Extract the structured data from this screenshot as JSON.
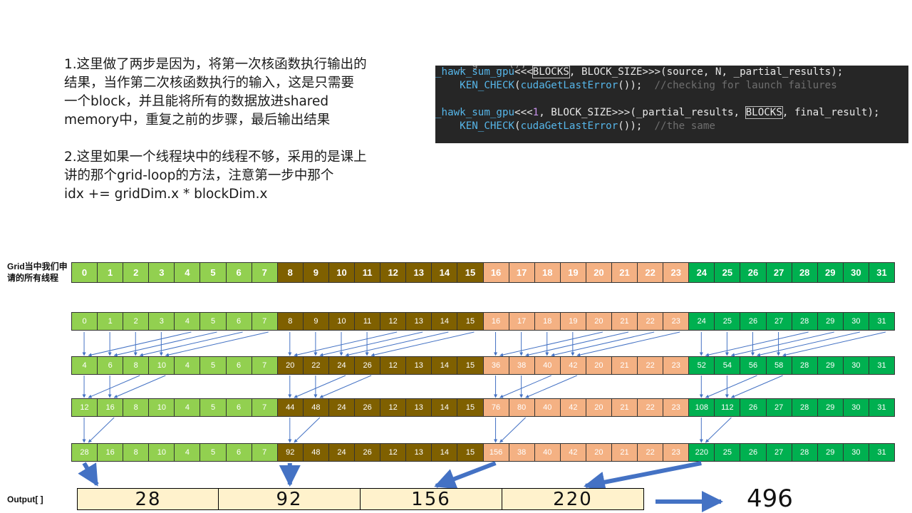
{
  "notes": {
    "line1": "1.这里做了两步是因为，将第一次核函数执行输出的",
    "line2": "结果，当作第二次核函数执行的输入，这是只需要",
    "line3": "一个block，并且能将所有的数据放进shared",
    "line4": "memory中，重复之前的步骤，最后输出结果",
    "line5": "2.这里如果一个线程块中的线程不够，采用的是课上",
    "line6": "讲的那个grid-loop的方法，注意第一步中那个",
    "line7": "idx += gridDim.x * blockDim.x"
  },
  "code": {
    "cut_line": "    _ g   _ ();",
    "l1_fn": "_hawk_sum_gpu",
    "l1_a": "<<<",
    "l1_blocks": "BLOCKS",
    "l1_b": ", BLOCK_SIZE>>>(source, N, _partial_results);",
    "l2_indent": "    ",
    "l2_fn": "KEN_CHECK",
    "l2_a": "(",
    "l2_fn2": "cudaGetLastError",
    "l2_b": "());  ",
    "l2_cm": "//checking for launch failures",
    "l4_fn": "_hawk_sum_gpu",
    "l4_a": "<<<",
    "l4_num": "1",
    "l4_b": ", BLOCK_SIZE>>>(_partial_results, ",
    "l4_blocks": "BLOCKS",
    "l4_c": ", final_result);",
    "l5_indent": "    ",
    "l5_fn": "KEN_CHECK",
    "l5_a": "(",
    "l5_fn2": "cudaGetLastError",
    "l5_b": "());  ",
    "l5_cm": "//the same"
  },
  "grid_label": "Grid当中我们申请的所有线程",
  "colors": {
    "block0": "#92d050",
    "block1": "#7f6000",
    "block2": "#f4b183",
    "block3": "#00b050",
    "arrow": "#4472c4",
    "output_fill": "#fff2cc"
  },
  "rows": [
    [
      "0",
      "1",
      "2",
      "3",
      "4",
      "5",
      "6",
      "7",
      "8",
      "9",
      "10",
      "11",
      "12",
      "13",
      "14",
      "15",
      "16",
      "17",
      "18",
      "19",
      "20",
      "21",
      "22",
      "23",
      "24",
      "25",
      "26",
      "27",
      "28",
      "29",
      "30",
      "31"
    ],
    [
      "0",
      "1",
      "2",
      "3",
      "4",
      "5",
      "6",
      "7",
      "8",
      "9",
      "10",
      "11",
      "12",
      "13",
      "14",
      "15",
      "16",
      "17",
      "18",
      "19",
      "20",
      "21",
      "22",
      "23",
      "24",
      "25",
      "26",
      "27",
      "28",
      "29",
      "30",
      "31"
    ],
    [
      "4",
      "6",
      "8",
      "10",
      "4",
      "5",
      "6",
      "7",
      "20",
      "22",
      "24",
      "26",
      "12",
      "13",
      "14",
      "15",
      "36",
      "38",
      "40",
      "42",
      "20",
      "21",
      "22",
      "23",
      "52",
      "54",
      "56",
      "58",
      "28",
      "29",
      "30",
      "31"
    ],
    [
      "12",
      "16",
      "8",
      "10",
      "4",
      "5",
      "6",
      "7",
      "44",
      "48",
      "24",
      "26",
      "12",
      "13",
      "14",
      "15",
      "76",
      "80",
      "40",
      "42",
      "20",
      "21",
      "22",
      "23",
      "108",
      "112",
      "26",
      "27",
      "28",
      "29",
      "30",
      "31"
    ],
    [
      "28",
      "16",
      "8",
      "10",
      "4",
      "5",
      "6",
      "7",
      "92",
      "48",
      "24",
      "26",
      "12",
      "13",
      "14",
      "15",
      "156",
      "38",
      "40",
      "42",
      "20",
      "21",
      "22",
      "23",
      "220",
      "25",
      "26",
      "27",
      "28",
      "29",
      "30",
      "31"
    ]
  ],
  "output_label": "Output[ ]",
  "outputs": [
    "28",
    "92",
    "156",
    "220"
  ],
  "total": "496"
}
